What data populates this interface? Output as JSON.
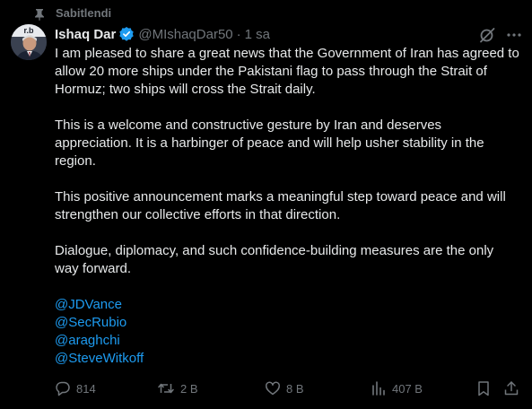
{
  "pinned": {
    "label": "Sabitlendi",
    "icon": "pin-icon"
  },
  "author": {
    "display_name": "Ishaq Dar",
    "handle": "@MIshaqDar50",
    "separator": "·",
    "timestamp": "1 sa",
    "verified_icon": "verified-badge-icon",
    "avatar_text": "r.b"
  },
  "header_icons": [
    "grok-icon",
    "more-icon"
  ],
  "post": {
    "paragraphs": [
      "I am pleased to share a great news that the Government of Iran has agreed to allow 20 more ships under the Pakistani flag to pass through the Strait of Hormuz; two ships will cross the Strait daily.",
      "This is a welcome and constructive gesture by Iran and deserves appreciation. It is a harbinger of peace and will help usher stability in the region.",
      "This positive announcement marks a meaningful step toward peace and will strengthen our collective efforts in that direction.",
      "Dialogue, diplomacy, and such confidence-building measures are the only way forward."
    ],
    "mentions": [
      "@JDVance",
      "@SecRubio",
      "@araghchi",
      "@SteveWitkoff"
    ]
  },
  "actions": {
    "reply": {
      "icon": "reply-icon",
      "count": "814"
    },
    "repost": {
      "icon": "repost-icon",
      "count": "2 B"
    },
    "like": {
      "icon": "like-icon",
      "count": "8 B"
    },
    "views": {
      "icon": "views-icon",
      "count": "407 B"
    },
    "bookmark": {
      "icon": "bookmark-icon"
    },
    "share": {
      "icon": "share-icon"
    }
  },
  "colors": {
    "background": "#000000",
    "text": "#e7e9ea",
    "secondary": "#71767b",
    "link": "#1d9bf0",
    "verified": "#1d9bf0"
  }
}
